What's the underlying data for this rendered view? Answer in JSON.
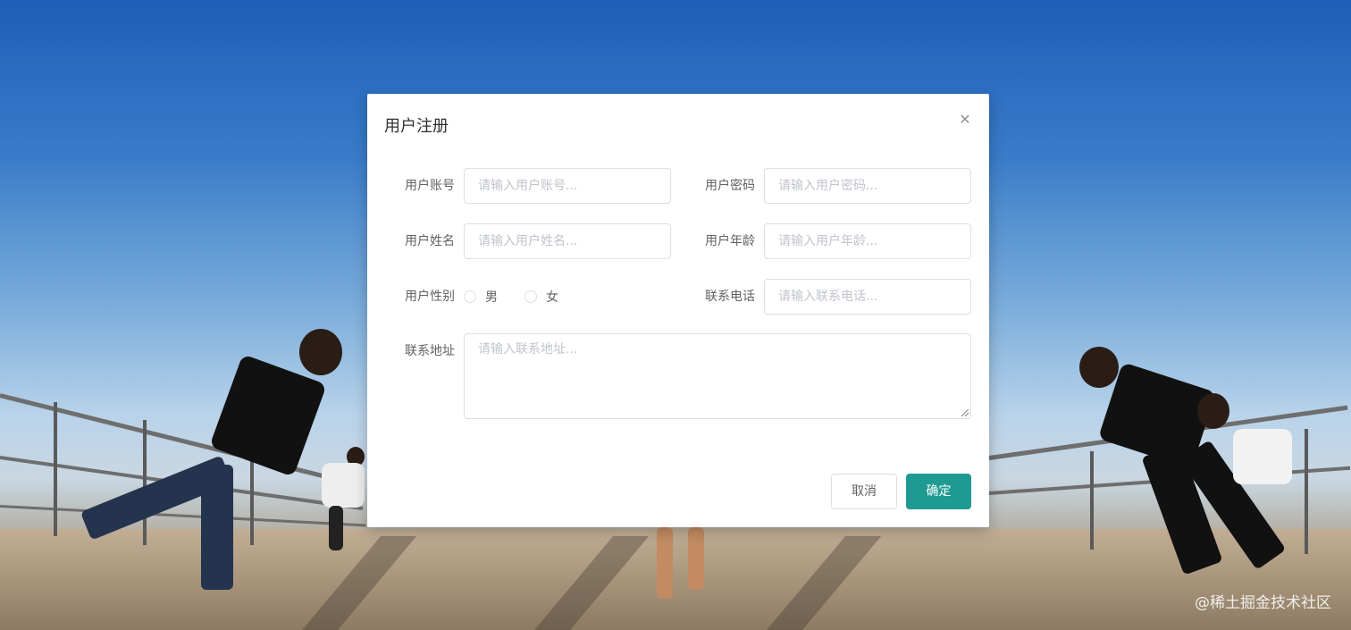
{
  "dialog": {
    "title": "用户注册",
    "close_icon": "close-icon"
  },
  "form": {
    "account": {
      "label": "用户账号",
      "placeholder": "请输入用户账号..."
    },
    "password": {
      "label": "用户密码",
      "placeholder": "请输入用户密码..."
    },
    "name": {
      "label": "用户姓名",
      "placeholder": "请输入用户姓名..."
    },
    "age": {
      "label": "用户年龄",
      "placeholder": "请输入用户年龄..."
    },
    "gender": {
      "label": "用户性别",
      "options": [
        "男",
        "女"
      ]
    },
    "phone": {
      "label": "联系电话",
      "placeholder": "请输入联系电话..."
    },
    "address": {
      "label": "联系地址",
      "placeholder": "请输入联系地址..."
    }
  },
  "buttons": {
    "cancel": "取消",
    "confirm": "确定"
  },
  "watermark": "@稀土掘金技术社区",
  "colors": {
    "primary": "#1e9a93",
    "border": "#dcdfe6",
    "placeholder": "#c0c4cc",
    "label": "#606266"
  }
}
